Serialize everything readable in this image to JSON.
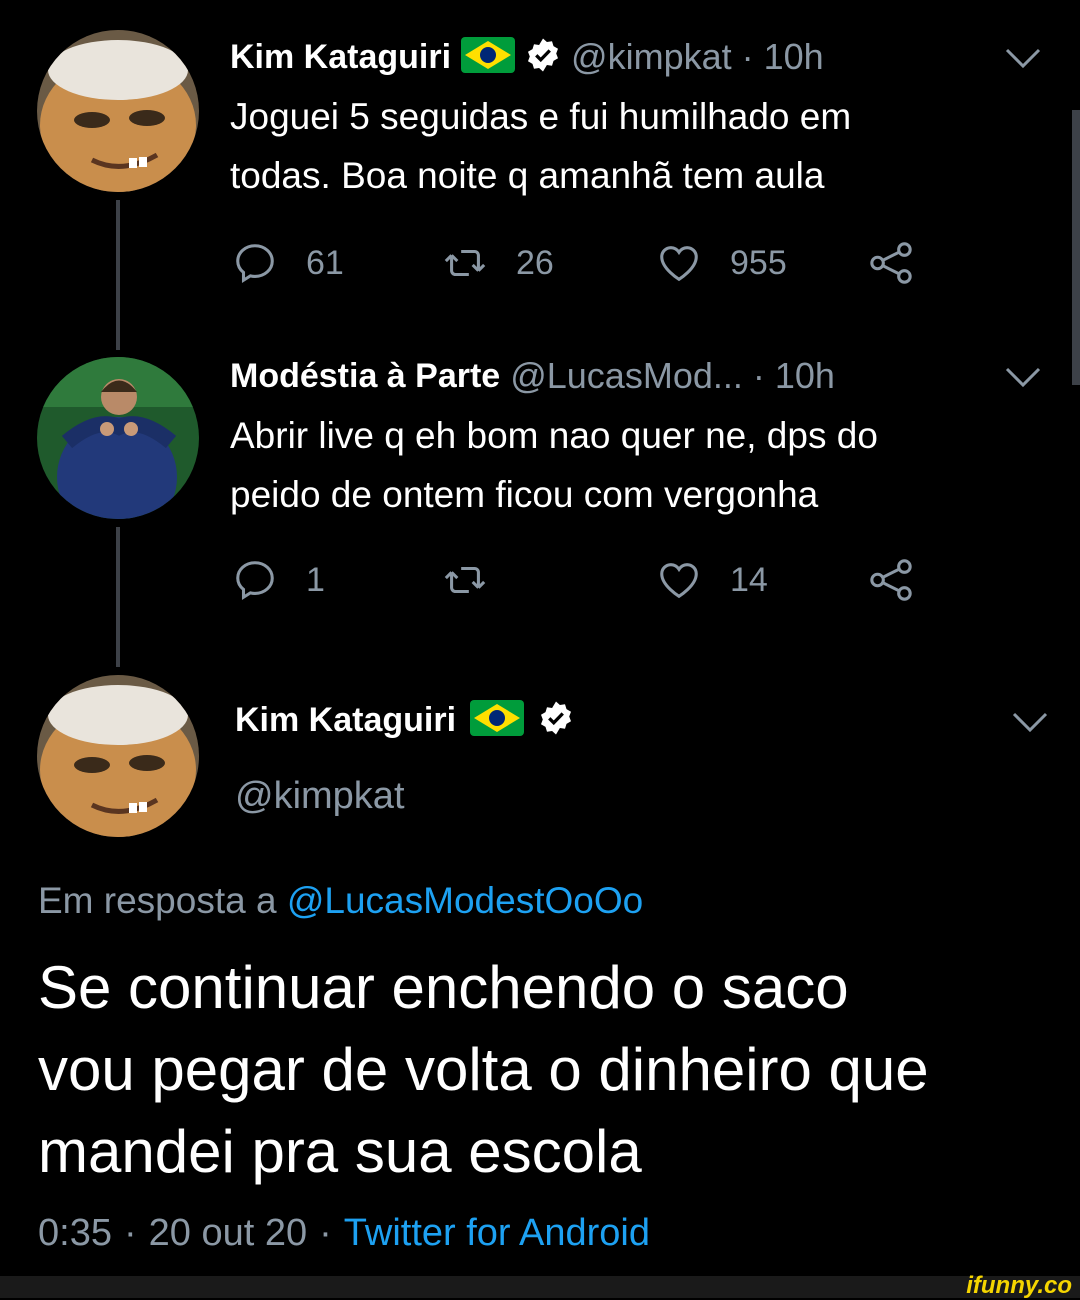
{
  "tweets": [
    {
      "name": "Kim Kataguiri",
      "handle": "@kimpkat",
      "separator": "·",
      "time": "10h",
      "text_line1": "Joguei 5 seguidas e fui humilhado em",
      "text_line2": "todas. Boa noite q amanhã tem aula",
      "replies": "61",
      "retweets": "26",
      "likes": "955"
    },
    {
      "name": "Modéstia à Parte",
      "handle": "@LucasMod...",
      "separator": "·",
      "time": "10h",
      "text_line1": "Abrir live q eh bom nao quer ne, dps do",
      "text_line2": "peido de ontem ficou com vergonha",
      "replies": "1",
      "retweets": "",
      "likes": "14"
    }
  ],
  "main_tweet": {
    "name": "Kim Kataguiri",
    "handle": "@kimpkat",
    "reply_prefix": "Em resposta a",
    "reply_to": "@LucasModestOoOo",
    "text_line1": "Se continuar enchendo o saco",
    "text_line2": "vou pegar de volta o dinheiro que",
    "text_line3": "mandei pra sua escola",
    "time": "0:35",
    "sep1": "·",
    "date": "20 out 20",
    "sep2": "·",
    "source": "Twitter for Android"
  },
  "watermark": "ifunny.co",
  "colors": {
    "background": "#000000",
    "secondary_text": "#8b98a5",
    "link": "#1da1f2",
    "verified_badge": "#ffffff",
    "thread_line": "#3d4148"
  },
  "icons": [
    "reply-icon",
    "retweet-icon",
    "like-icon",
    "share-icon",
    "chevron-down-icon",
    "verified-icon",
    "brazil-flag-icon"
  ]
}
